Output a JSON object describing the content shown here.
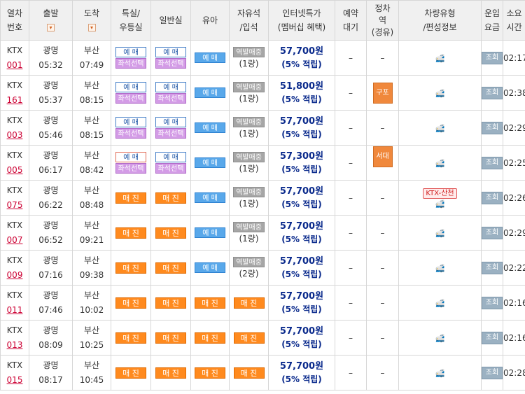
{
  "header": {
    "train_no": [
      "열차",
      "번호"
    ],
    "dep": "출발",
    "arr": "도착",
    "special": [
      "특실/",
      "우등실"
    ],
    "general": "일반실",
    "infant": "유아",
    "free": [
      "자유석",
      "/입석"
    ],
    "internet": [
      "인터넷특가",
      "(멤버십 혜택)"
    ],
    "reserve_wait": [
      "예약",
      "대기"
    ],
    "stop": [
      "정차",
      "역",
      "(경유)"
    ],
    "car_type": [
      "차량유형",
      "/편성정보"
    ],
    "fare": [
      "운임",
      "요금"
    ],
    "duration": [
      "소요",
      "시간"
    ]
  },
  "labels": {
    "reserve": "예 매",
    "seat_select": "좌석선택",
    "sold_out": "매 진",
    "station_sale": "역발매중",
    "inquiry": "조회",
    "dash": "–",
    "train_glyph": "🚅"
  },
  "rows": [
    {
      "type": "KTX",
      "no": "001",
      "dep_st": "광명",
      "dep_t": "05:32",
      "arr_st": "부산",
      "arr_t": "07:49",
      "special": "reserve_seat",
      "general": "reserve_seat",
      "infant": "reserve",
      "free_count": "(1량)",
      "price": "57,700원",
      "pct": "(5% 적립)",
      "wait": "–",
      "stop": "",
      "car_tag": "",
      "duration": "02:17"
    },
    {
      "type": "KTX",
      "no": "161",
      "dep_st": "광명",
      "dep_t": "05:37",
      "arr_st": "부산",
      "arr_t": "08:15",
      "special": "reserve_seat",
      "general": "reserve_seat",
      "infant": "reserve",
      "free_count": "(1량)",
      "price": "51,800원",
      "pct": "(5% 적립)",
      "wait": "–",
      "stop": "구포",
      "car_tag": "",
      "duration": "02:38"
    },
    {
      "type": "KTX",
      "no": "003",
      "dep_st": "광명",
      "dep_t": "05:46",
      "arr_st": "부산",
      "arr_t": "08:15",
      "special": "reserve_seat",
      "general": "reserve_seat",
      "infant": "reserve",
      "free_count": "(1량)",
      "price": "57,700원",
      "pct": "(5% 적립)",
      "wait": "–",
      "stop": "",
      "car_tag": "",
      "duration": "02:29"
    },
    {
      "type": "KTX",
      "no": "005",
      "dep_st": "광명",
      "dep_t": "06:17",
      "arr_st": "부산",
      "arr_t": "08:42",
      "special": "reserve_seat_sel",
      "general": "reserve_seat",
      "infant": "reserve",
      "free_count": "(1량)",
      "price": "57,300원",
      "pct": "(5% 적립)",
      "wait": "–",
      "stop": "서대구",
      "car_tag": "",
      "duration": "02:25"
    },
    {
      "type": "KTX",
      "no": "075",
      "dep_st": "광명",
      "dep_t": "06:22",
      "arr_st": "부산",
      "arr_t": "08:48",
      "special": "sold",
      "general": "sold",
      "infant": "reserve",
      "free_count": "(1량)",
      "price": "57,700원",
      "pct": "(5% 적립)",
      "wait": "–",
      "stop": "",
      "car_tag": "KTX-산천",
      "duration": "02:26"
    },
    {
      "type": "KTX",
      "no": "007",
      "dep_st": "광명",
      "dep_t": "06:52",
      "arr_st": "부산",
      "arr_t": "09:21",
      "special": "sold",
      "general": "sold",
      "infant": "reserve",
      "free_count": "(1량)",
      "price": "57,700원",
      "pct": "(5% 적립)",
      "wait": "–",
      "stop": "",
      "car_tag": "",
      "duration": "02:29"
    },
    {
      "type": "KTX",
      "no": "009",
      "dep_st": "광명",
      "dep_t": "07:16",
      "arr_st": "부산",
      "arr_t": "09:38",
      "special": "sold",
      "general": "sold",
      "infant": "reserve",
      "free_count": "(2량)",
      "price": "57,700원",
      "pct": "(5% 적립)",
      "wait": "–",
      "stop": "",
      "car_tag": "",
      "duration": "02:22"
    },
    {
      "type": "KTX",
      "no": "011",
      "dep_st": "광명",
      "dep_t": "07:46",
      "arr_st": "부산",
      "arr_t": "10:02",
      "special": "sold",
      "general": "sold",
      "infant": "sold",
      "free_count": "",
      "price": "57,700원",
      "pct": "(5% 적립)",
      "wait": "–",
      "stop": "",
      "car_tag": "",
      "duration": "02:16"
    },
    {
      "type": "KTX",
      "no": "013",
      "dep_st": "광명",
      "dep_t": "08:09",
      "arr_st": "부산",
      "arr_t": "10:25",
      "special": "sold",
      "general": "sold",
      "infant": "sold",
      "free_count": "",
      "price": "57,700원",
      "pct": "(5% 적립)",
      "wait": "–",
      "stop": "",
      "car_tag": "",
      "duration": "02:16"
    },
    {
      "type": "KTX",
      "no": "015",
      "dep_st": "광명",
      "dep_t": "08:17",
      "arr_st": "부산",
      "arr_t": "10:45",
      "special": "sold",
      "general": "sold",
      "infant": "sold",
      "free_count": "",
      "price": "57,700원",
      "pct": "(5% 적립)",
      "wait": "–",
      "stop": "",
      "car_tag": "",
      "duration": "02:28"
    }
  ]
}
